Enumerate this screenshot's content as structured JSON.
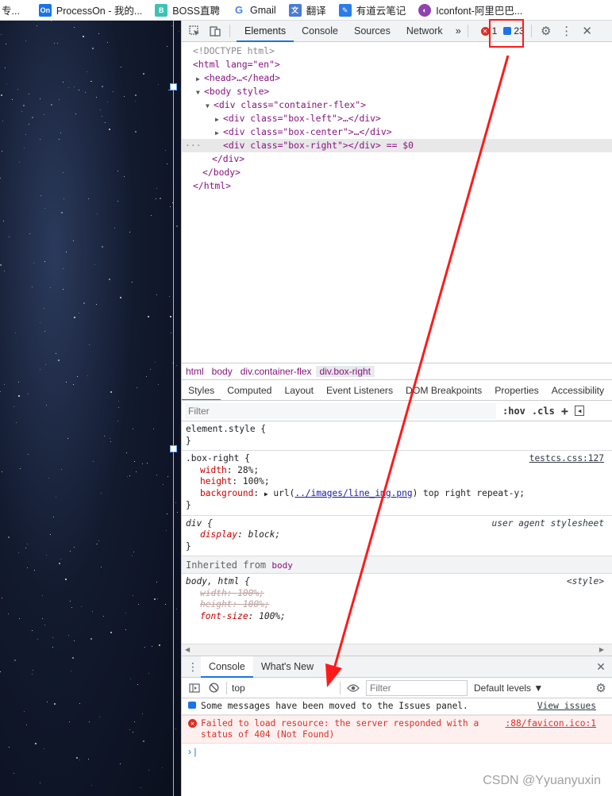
{
  "bookmarks": [
    {
      "label": "专...",
      "icon": "folder-icon"
    },
    {
      "label": "ProcessOn - 我的...",
      "icon": "processon-icon",
      "badge": "On",
      "color": "#1a73e8"
    },
    {
      "label": "BOSS直聘",
      "icon": "boss-icon",
      "badge": "B",
      "color": "#3dc2b5"
    },
    {
      "label": "Gmail",
      "icon": "google-icon",
      "badge": "G",
      "color": "#ffffff"
    },
    {
      "label": "翻译",
      "icon": "translate-icon",
      "badge": "文",
      "color": "#4a7bd8"
    },
    {
      "label": "有道云笔记",
      "icon": "youdao-icon",
      "badge": "✎",
      "color": "#2b7de9"
    },
    {
      "label": "Iconfont-阿里巴巴...",
      "icon": "iconfont-icon",
      "badge": "◐",
      "color": "#8e44ad"
    }
  ],
  "devtools": {
    "tabs": [
      "Elements",
      "Console",
      "Sources",
      "Network"
    ],
    "more": "»",
    "error_count": "1",
    "issue_count": "23",
    "dom": [
      {
        "t": "<!DOCTYPE html>"
      },
      {
        "t": "<html lang=\"en\">"
      },
      {
        "t": "<head>…</head>"
      },
      {
        "t": "<body style>"
      },
      {
        "t": "<div class=\"container-flex\">"
      },
      {
        "t": "<div class=\"box-left\">…</div>"
      },
      {
        "t": "<div class=\"box-center\">…</div>"
      },
      {
        "t": "<div class=\"box-right\"></div> == $0"
      },
      {
        "t": "</div>"
      },
      {
        "t": "</body>"
      },
      {
        "t": "</html>"
      }
    ],
    "breadcrumbs": [
      "html",
      "body",
      "div.container-flex",
      "div.box-right"
    ],
    "subtabs": [
      "Styles",
      "Computed",
      "Layout",
      "Event Listeners",
      "DOM Breakpoints",
      "Properties",
      "Accessibility"
    ],
    "filter_placeholder": "Filter",
    "hov": ":hov",
    "cls": ".cls",
    "element_style": "element.style {",
    "close_brace": "}",
    "rule1": {
      "selector": ".box-right {",
      "source": "testcs.css:127",
      "width": "28%;",
      "height": "100%;",
      "bg_prefix": "url(",
      "bg_link": "../images/line_img.png",
      "bg_suffix": ") top right repeat-y;"
    },
    "rule2": {
      "selector": "div {",
      "source": "user agent stylesheet",
      "prop": "display",
      "val": "block;"
    },
    "inherited_label": "Inherited from ",
    "inherited_tag": "body",
    "rule3": {
      "selector": "body, html {",
      "source": "<style>",
      "width": "100%;",
      "height": "100%;",
      "fontsize": "100%;"
    }
  },
  "drawer": {
    "tabs": [
      "Console",
      "What's New"
    ],
    "context": "top",
    "filter_placeholder": "Filter",
    "levels": "Default levels ▼",
    "info_msg": "Some messages have been moved to the Issues panel.",
    "info_link": "View issues",
    "err_msg1": "Failed to load resource: the server responded with a",
    "err_msg2": "status of 404 (Not Found)",
    "err_src": ":88/favicon.ico:1"
  },
  "watermark": "CSDN @Yyuanyuxin",
  "colors": {
    "accent": "#1a73e8",
    "error": "#d93025",
    "annotation": "#ff1a1a"
  }
}
